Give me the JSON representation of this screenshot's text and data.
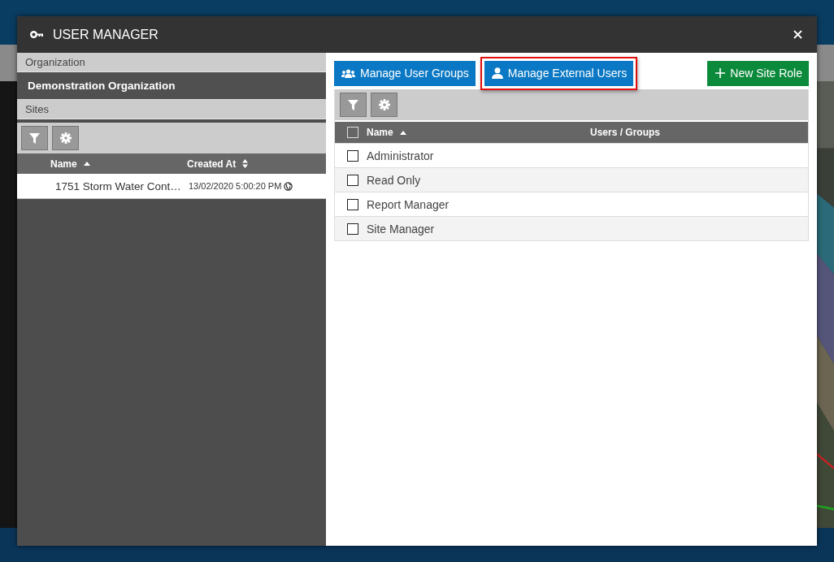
{
  "window": {
    "title": "USER MANAGER"
  },
  "sidebar": {
    "organization_label": "Organization",
    "organization": "Demonstration Organization",
    "sites_label": "Sites",
    "columns": [
      {
        "label": "Name",
        "kind": "sorted"
      },
      {
        "label": "Created At",
        "kind": "sortable"
      }
    ],
    "rows": [
      {
        "name": "1751 Storm Water Cont…",
        "created_at": "13/02/2020 5:00:20 PM"
      }
    ]
  },
  "actions": [
    {
      "label": "Manage User Groups",
      "kind": "groups",
      "highlighted": false
    },
    {
      "label": "Manage External Users",
      "kind": "user",
      "highlighted": true
    },
    {
      "label": "New Site Role",
      "kind": "add",
      "highlighted": false
    }
  ],
  "roles": {
    "columns": [
      {
        "label": "Name",
        "kind": "sorted"
      },
      {
        "label": "Users / Groups",
        "kind": "plain"
      }
    ],
    "all_checked": false,
    "rows": [
      {
        "name": "Administrator",
        "checked": false
      },
      {
        "name": "Read Only",
        "checked": false
      },
      {
        "name": "Report Manager",
        "checked": false
      },
      {
        "name": "Site Manager",
        "checked": false
      }
    ]
  }
}
